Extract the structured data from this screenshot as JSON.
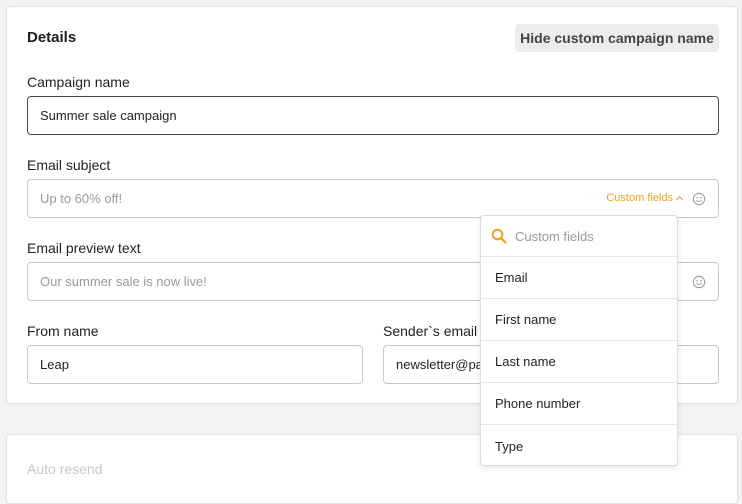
{
  "details": {
    "title": "Details",
    "hide_button_label": "Hide custom campaign name",
    "campaign_name": {
      "label": "Campaign name",
      "value": "Summer sale campaign"
    },
    "email_subject": {
      "label": "Email subject",
      "placeholder": "Up to 60% off!",
      "custom_fields_label": "Custom fields"
    },
    "email_preview": {
      "label": "Email preview text",
      "placeholder": "Our summer sale is now live!"
    },
    "from_name": {
      "label": "From name",
      "value": "Leap"
    },
    "sender_email": {
      "label": "Sender`s email a",
      "value": "newsletter@pa"
    }
  },
  "auto_resend": {
    "title": "Auto resend"
  },
  "custom_fields_dropdown": {
    "search_placeholder": "Custom fields",
    "items": [
      "Email",
      "First name",
      "Last name",
      "Phone number",
      "Type"
    ]
  },
  "colors": {
    "accent": "#f0a01f",
    "border": "#c9c9c9",
    "focused_border": "#4a4a4a",
    "button_bg": "#ececec"
  },
  "icons": {
    "search": "search-icon",
    "emoji": "emoji-icon",
    "chevron": "chevron-up-icon"
  }
}
